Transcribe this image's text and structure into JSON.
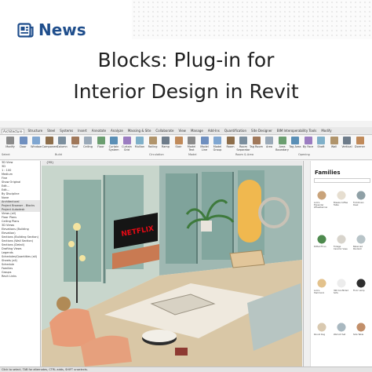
{
  "header": {
    "badge": {
      "icon": "newspaper-icon",
      "text": "News"
    },
    "headline": [
      "Blocks: Plug-in for",
      "Interior Design in Revit"
    ],
    "brand_color": "#1f4e8c"
  },
  "revit": {
    "tabs": [
      "Architecture",
      "Structure",
      "Steel",
      "Systems",
      "Insert",
      "Annotate",
      "Analyze",
      "Massing & Site",
      "Collaborate",
      "View",
      "Manage",
      "Add-Ins",
      "Quantification",
      "Site Designer",
      "BIM Interoperability Tools",
      "Modify"
    ],
    "active_tab": "Architecture",
    "ribbon_tools": [
      "Modify",
      "Door",
      "Window",
      "Component",
      "Column",
      "Roof",
      "Ceiling",
      "Floor",
      "Curtain System",
      "Curtain Grid",
      "Mullion",
      "Railing",
      "Ramp",
      "Stair",
      "Model Text",
      "Model Line",
      "Model Group",
      "Room",
      "Room Separator",
      "Tag Room",
      "Area",
      "Area Boundary",
      "Tag Area",
      "By Face",
      "Shaft",
      "Wall",
      "Vertical",
      "Dormer"
    ],
    "ribbon_groups": [
      "Select",
      "Build",
      "Circulation",
      "Model",
      "Room & Area",
      "Opening"
    ],
    "left_panel": {
      "lines": [
        "3D View",
        "3D",
        "1 : 100",
        "Medium",
        "Fine",
        "Show Original",
        "Edit...",
        "Edit...",
        "By Discipline",
        "None",
        "Architectural",
        "Project Browser - Blocks Project Autodesk",
        "Views (all)",
        "Floor Plans",
        "Ceiling Plans",
        "3D Views",
        "Elevations (Building Elevation)",
        "Sections (Building Section)",
        "Sections (Wall Section)",
        "Sections (Detail)",
        "Drafting Views",
        "Legends",
        "Schedules/Quantities (all)",
        "Sheets (all)",
        "Schedule",
        "Families",
        "Groups",
        "Revit Links"
      ],
      "properties_label": "3D Views: {3D}",
      "apply_label": "Apply",
      "type_label": "3D View",
      "edit_label": "Edit...",
      "detail_level": "Medium",
      "scale": "1 : 100"
    },
    "view_tab": "{3D}",
    "tv_brand": "NETFLIX",
    "right_panel": {
      "title": "Families",
      "items": [
        "Lolo's Expander Wheelbarrow",
        "Breeze Coffee Table",
        "Fold-Down Desk",
        "Potted Ficus",
        "Foliage Ceramic Vase",
        "Balanced Pendant",
        "Lolo's Hammock",
        "300 Conflicted Sofa",
        "Floor Lamp",
        "Round Rug",
        "Wall Art Set",
        "Side Table"
      ]
    },
    "status_text": "Click to select, TAB for alternates, CTRL adds, SHIFT unselects.",
    "main_model": "Main Model"
  }
}
